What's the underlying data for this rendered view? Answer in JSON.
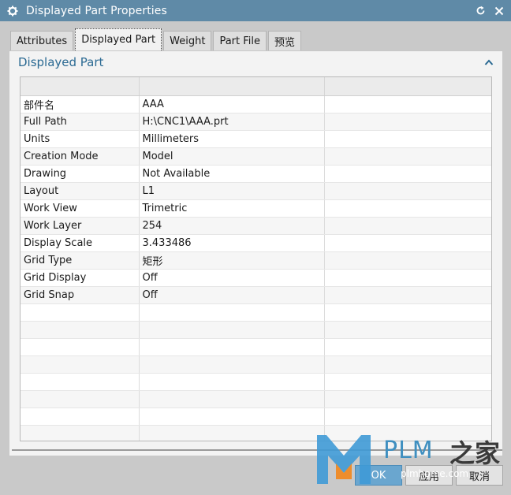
{
  "window": {
    "title": "Displayed Part Properties"
  },
  "tabs": [
    {
      "label": "Attributes",
      "active": false
    },
    {
      "label": "Displayed Part",
      "active": true
    },
    {
      "label": "Weight",
      "active": false
    },
    {
      "label": "Part File",
      "active": false
    },
    {
      "label": "预览",
      "active": false
    }
  ],
  "group": {
    "title": "Displayed Part"
  },
  "table": {
    "rows": [
      {
        "name": "部件名",
        "value": "AAA"
      },
      {
        "name": "Full Path",
        "value": "H:\\CNC1\\AAA.prt"
      },
      {
        "name": "Units",
        "value": "Millimeters"
      },
      {
        "name": "Creation Mode",
        "value": "Model"
      },
      {
        "name": "Drawing",
        "value": "Not Available"
      },
      {
        "name": "Layout",
        "value": "L1"
      },
      {
        "name": "Work View",
        "value": "Trimetric"
      },
      {
        "name": "Work Layer",
        "value": "254"
      },
      {
        "name": "Display Scale",
        "value": "3.433486"
      },
      {
        "name": "Grid Type",
        "value": "矩形"
      },
      {
        "name": "Grid Display",
        "value": "Off"
      },
      {
        "name": "Grid Snap",
        "value": "Off"
      }
    ]
  },
  "buttons": {
    "ok": "OK",
    "apply": "应用",
    "cancel": "取消"
  },
  "watermark": {
    "text": "PLM",
    "cn": "之家",
    "url": "plmhome.com"
  },
  "colors": {
    "titlebar": "#5f8aa7",
    "accent": "#2b6a93"
  }
}
